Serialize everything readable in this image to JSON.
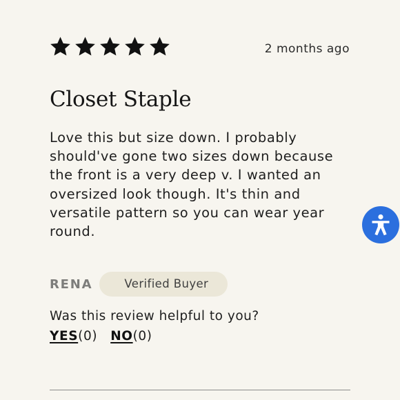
{
  "review": {
    "rating": 5,
    "rating_max": 5,
    "date": "2 months ago",
    "title": "Closet Staple",
    "body": "Love this but size down. I probably should've gone two sizes down because the front is a very deep v. I wanted an oversized look though. It's thin and versatile pattern so you can wear year round.",
    "reviewer_name": "RENA",
    "badge": "Verified Buyer"
  },
  "helpful": {
    "question": "Was this review helpful to you?",
    "yes_label": "YES",
    "yes_count": "(0)",
    "no_label": "NO",
    "no_count": "(0)"
  },
  "icons": {
    "star": "star-icon",
    "accessibility": "accessibility-icon"
  },
  "colors": {
    "background": "#f7f5ef",
    "badge_background": "#ebe7d8",
    "accessibility_button": "#2b6fde",
    "star": "#111111"
  }
}
